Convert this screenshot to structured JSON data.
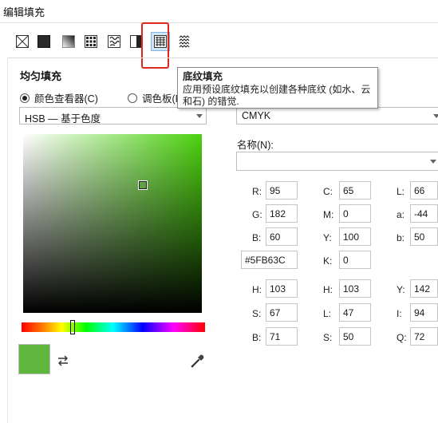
{
  "window": {
    "title": "编辑填充"
  },
  "fill_tabs": [
    {
      "name": "no-fill",
      "icon": "no-fill-icon"
    },
    {
      "name": "uniform-fill",
      "icon": "uniform-fill-icon"
    },
    {
      "name": "fountain-fill",
      "icon": "fountain-fill-icon"
    },
    {
      "name": "vector-pattern-fill",
      "icon": "vector-pattern-icon"
    },
    {
      "name": "bitmap-pattern-fill",
      "icon": "bitmap-pattern-icon"
    },
    {
      "name": "two-color-pattern-fill",
      "icon": "two-color-pattern-icon"
    },
    {
      "name": "texture-fill",
      "icon": "texture-fill-icon",
      "selected": true
    },
    {
      "name": "postscript-fill",
      "icon": "postscript-fill-icon"
    }
  ],
  "uniform": {
    "section_title": "均匀填充",
    "radio_viewers": "颜色查看器(C)",
    "radio_palettes": "调色板(P)",
    "model_select": "HSB — 基于色度",
    "color_model": "CMYK",
    "swatch_color": "#5FB63C"
  },
  "tooltip": {
    "title": "底纹填充",
    "body": "应用预设底纹填充以创建各种底纹 (如水、云和石) 的错觉."
  },
  "name": {
    "label": "名称(N):",
    "value": ""
  },
  "rgb": {
    "r_label": "R:",
    "r": "95",
    "g_label": "G:",
    "g": "182",
    "b_label": "B:",
    "b": "60",
    "hex": "#5FB63C"
  },
  "cmyk": {
    "c_label": "C:",
    "c": "65",
    "m_label": "M:",
    "m": "0",
    "y_label": "Y:",
    "y": "100",
    "k_label": "K:",
    "k": "0"
  },
  "lab": {
    "l_label": "L:",
    "l": "66",
    "a_label": "a:",
    "a": "-44",
    "b_label": "b:",
    "b": "50"
  },
  "hsb": {
    "h_label": "H:",
    "h": "103",
    "s_label": "S:",
    "s": "67",
    "b_label": "B:",
    "b": "71"
  },
  "hls": {
    "h_label": "H:",
    "h": "103",
    "l_label": "L:",
    "l": "47",
    "s_label": "S:",
    "s": "50"
  },
  "yiq": {
    "y_label": "Y:",
    "y": "142",
    "i_label": "I:",
    "i": "94",
    "q_label": "Q:",
    "q": "72"
  }
}
